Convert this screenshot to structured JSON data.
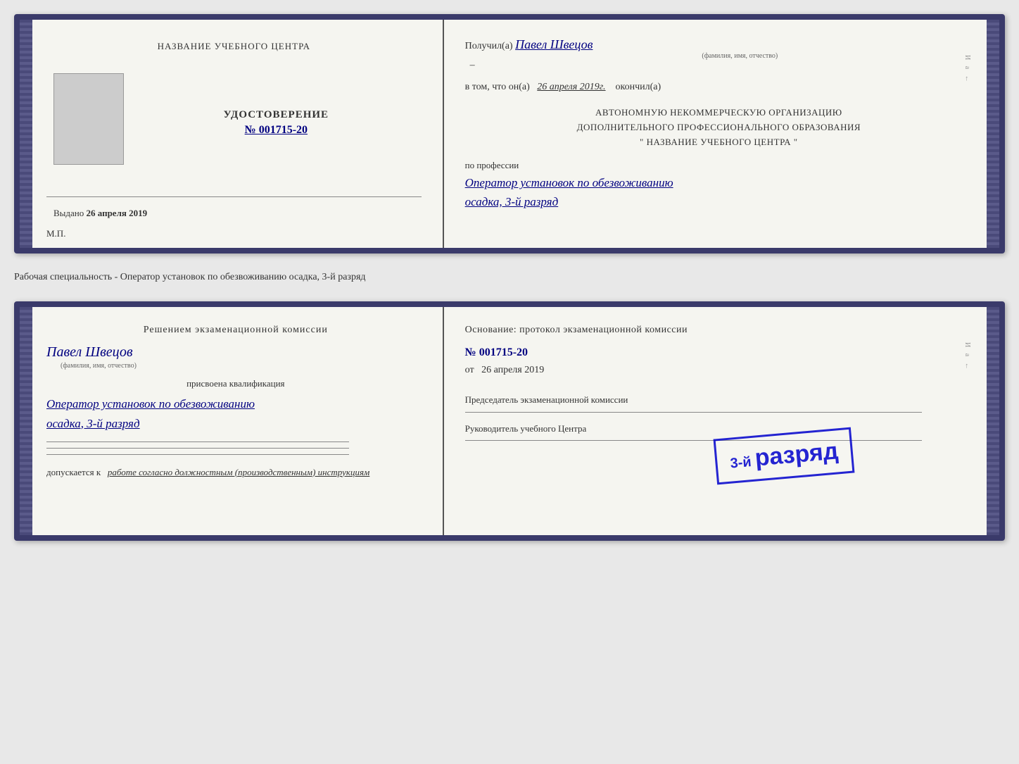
{
  "page": {
    "background_color": "#e8e8e8"
  },
  "doc1": {
    "left": {
      "center_name": "НАЗВАНИЕ УЧЕБНОГО ЦЕНТРА",
      "cert_title": "УДОСТОВЕРЕНИЕ",
      "cert_number": "№ 001715-20",
      "issued_label": "Выдано",
      "issued_date": "26 апреля 2019",
      "mp_label": "М.П."
    },
    "right": {
      "received_prefix": "Получил(а)",
      "received_name": "Павел Швецов",
      "fio_subtitle": "(фамилия, имя, отчество)",
      "dash": "–",
      "date_prefix": "в том, что он(а)",
      "date_value": "26 апреля 2019г.",
      "date_suffix": "окончил(а)",
      "org_line1": "АВТОНОМНУЮ НЕКОММЕРЧЕСКУЮ ОРГАНИЗАЦИЮ",
      "org_line2": "ДОПОЛНИТЕЛЬНОГО ПРОФЕССИОНАЛЬНОГО ОБРАЗОВАНИЯ",
      "org_line3": "\"  НАЗВАНИЕ УЧЕБНОГО ЦЕНТРА  \"",
      "profession_label": "по профессии",
      "profession_value": "Оператор установок по обезвоживанию",
      "rank_value": "осадка, 3-й разряд"
    }
  },
  "between_label": "Рабочая специальность - Оператор установок по обезвоживанию осадка, 3-й разряд",
  "doc2": {
    "left": {
      "decision_line": "Решением  экзаменационной  комиссии",
      "person_name": "Павел Швецов",
      "fio_subtitle": "(фамилия, имя, отчество)",
      "qualification_label": "присвоена квалификация",
      "profession_value": "Оператор установок по обезвоживанию",
      "rank_value": "осадка, 3-й разряд",
      "dopusk_prefix": "допускается к",
      "dopusk_value": "работе согласно должностным (производственным) инструкциям"
    },
    "right": {
      "osnov_label": "Основание: протокол экзаменационной  комиссии",
      "protocol_number": "№  001715-20",
      "from_prefix": "от",
      "from_date": "26 апреля 2019",
      "chairman_label": "Председатель экзаменационной комиссии",
      "head_label": "Руководитель учебного Центра"
    },
    "stamp": {
      "text": "3-й разряд",
      "line1": "3-й",
      "line2": "разряд"
    }
  },
  "right_edge_chars": {
    "top": "И",
    "middle": "а",
    "bottom": "←"
  }
}
